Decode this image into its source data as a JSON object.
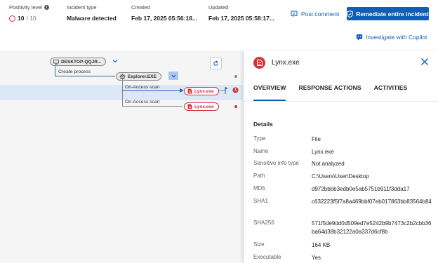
{
  "header": {
    "positivity": {
      "label": "Positivity level",
      "value": "10",
      "max": "/ 10"
    },
    "incident_type": {
      "label": "Incident type",
      "value": "Malware detected"
    },
    "created": {
      "label": "Created",
      "value": "Feb 17, 2025 05:56:18..."
    },
    "updated": {
      "label": "Updated",
      "value": "Feb 17, 2025 05:58:17..."
    },
    "post_comment": "Post comment",
    "remediate": "Remediate entire incident",
    "copilot": "Investigate with Copilot"
  },
  "graph": {
    "root_node": "DESKTOP-QQJR...",
    "create_process_label": "Create process",
    "explorer_node": "Explorer.EXE",
    "scan_label_1": "On-Access scan",
    "scan_label_2": "On-Access scan",
    "lynx_node_1": "Lynx.exe",
    "lynx_node_2": "Lynx.exe"
  },
  "panel": {
    "title": "Lynx.exe",
    "tabs": [
      "OVERVIEW",
      "RESPONSE ACTIONS",
      "ACTIVITIES"
    ],
    "section_title": "Details",
    "details": [
      {
        "k": "Type",
        "v": "File"
      },
      {
        "k": "Name",
        "v": "Lynx.exe"
      },
      {
        "k": "Sensitive info type",
        "v": "Not analyzed"
      },
      {
        "k": "Path",
        "v": "C:\\Users\\User\\Desktop"
      },
      {
        "k": "MD5",
        "v": "d972bbbb3edb0e5ab5751b911f3dda17"
      },
      {
        "k": "SHA1",
        "v": "c632223f5f7a8a469bbf07eb017863bb83564b84"
      },
      {
        "k": "SHA256",
        "v": "571f5de9dd0d509ed7e5242b9b7473c2b2cbb36ba64d38b32122a0a337d6cf8b"
      },
      {
        "k": "Size",
        "v": "164 KB"
      },
      {
        "k": "Executable",
        "v": "Yes"
      }
    ]
  },
  "colors": {
    "accent": "#0f5fb5",
    "danger": "#d13438",
    "highlight": "#dce8f6"
  }
}
